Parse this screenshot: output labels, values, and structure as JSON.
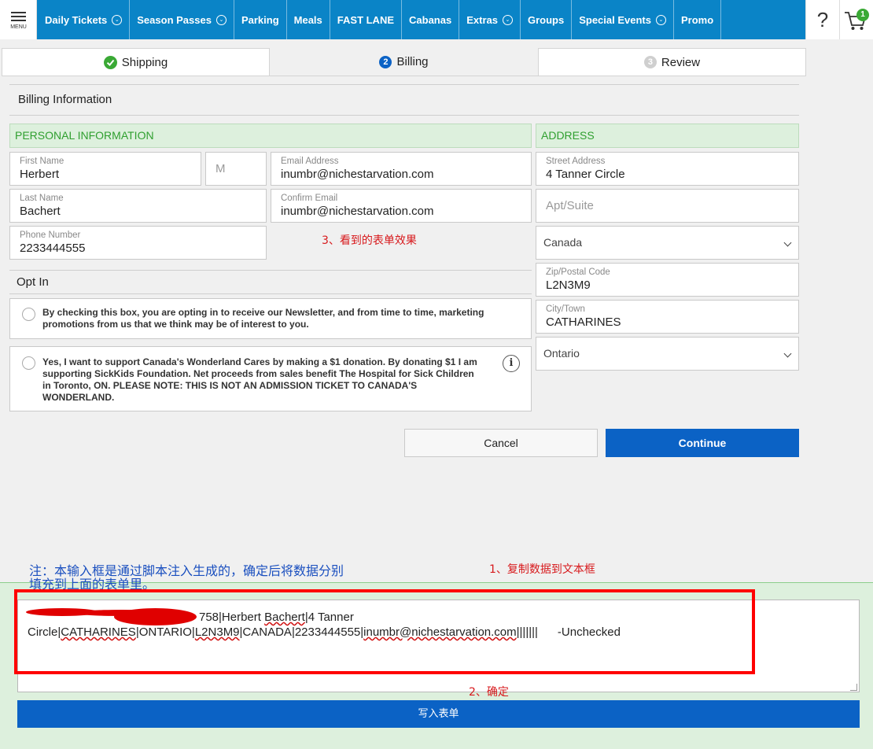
{
  "nav": {
    "menu_label": "MENU",
    "items": [
      {
        "label": "Daily Tickets",
        "dropdown": true
      },
      {
        "label": "Season Passes",
        "dropdown": true
      },
      {
        "label": "Parking",
        "dropdown": false
      },
      {
        "label": "Meals",
        "dropdown": false
      },
      {
        "label": "FAST LANE",
        "dropdown": false
      },
      {
        "label": "Cabanas",
        "dropdown": false
      },
      {
        "label": "Extras",
        "dropdown": true
      },
      {
        "label": "Groups",
        "dropdown": false
      },
      {
        "label": "Special Events",
        "dropdown": true
      },
      {
        "label": "Promo",
        "dropdown": false
      }
    ],
    "help_label": "?",
    "cart_count": "1",
    "colors": {
      "bar": "#0a84c7"
    }
  },
  "steps": [
    {
      "label": "Shipping",
      "icon": "check-circle-icon",
      "state": "done"
    },
    {
      "label": "Billing",
      "number": "2",
      "state": "active"
    },
    {
      "label": "Review",
      "number": "3",
      "state": "pending"
    }
  ],
  "billing": {
    "title": "Billing Information",
    "personal_header": "PERSONAL INFORMATION",
    "address_header": "ADDRESS",
    "first_name": {
      "label": "First Name",
      "value": "Herbert"
    },
    "middle_initial": {
      "placeholder": "M"
    },
    "email": {
      "label": "Email Address",
      "value": "inumbr@nichestarvation.com"
    },
    "last_name": {
      "label": "Last Name",
      "value": "Bachert"
    },
    "confirm_email": {
      "label": "Confirm Email",
      "value": "inumbr@nichestarvation.com"
    },
    "phone": {
      "label": "Phone Number",
      "value": "2233444555"
    },
    "street": {
      "label": "Street Address",
      "value": "4 Tanner Circle"
    },
    "apt": {
      "placeholder": "Apt/Suite"
    },
    "country": {
      "value": "Canada"
    },
    "zip": {
      "label": "Zip/Postal Code",
      "value": "L2N3M9"
    },
    "city": {
      "label": "City/Town",
      "value": "CATHARINES"
    },
    "province": {
      "value": "Ontario"
    }
  },
  "opt_in": {
    "title": "Opt In",
    "newsletter_line1": "By checking this box, you are opting in to receive our Newsletter, and from time to time, marketing",
    "newsletter_line2": "promotions from us that we think may be of interest to you.",
    "donation_line1": "Yes, I want to support Canada's Wonderland Cares by making a $1 donation. By donating $1 I am",
    "donation_line2": "supporting SickKids Foundation. Net proceeds from sales benefit The Hospital for Sick Children",
    "donation_line3": "in Toronto, ON. PLEASE NOTE: THIS IS NOT AN ADMISSION TICKET TO CANADA'S",
    "donation_line4": "WONDERLAND.",
    "info_icon_glyph": "i"
  },
  "actions": {
    "cancel": "Cancel",
    "continue": "Continue"
  },
  "annotations": {
    "step3": "3、看到的表单效果",
    "step1": "1、复制数据到文本框",
    "step2": "2、确定",
    "note_line1": "注：本输入框是通过脚本注入生成的，确定后将数据分别",
    "note_line2": "填充到上面的表单里。"
  },
  "injector": {
    "line1_part1": "758|Herbert ",
    "line1_wavy": "Bachert",
    "line1_part2": "|4 Tanner",
    "line2_segments": [
      {
        "text": "Circle|",
        "wavy": false
      },
      {
        "text": "CATHARINES",
        "wavy": true
      },
      {
        "text": "|ONTARIO|",
        "wavy": false
      },
      {
        "text": "L2N3M9",
        "wavy": true
      },
      {
        "text": "|CANADA|2233444555|",
        "wavy": false
      },
      {
        "text": "inumbr@nichestarvation.com",
        "wavy": true
      },
      {
        "text": "|||||||      -Unchecked",
        "wavy": false
      }
    ],
    "submit_label": "写入表单"
  }
}
